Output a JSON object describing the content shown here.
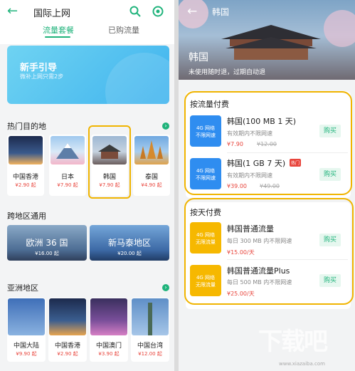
{
  "left": {
    "header": {
      "title": "国际上网"
    },
    "tabs": [
      {
        "label": "流量套餐"
      },
      {
        "label": "已购流量"
      }
    ],
    "banner": {
      "title": "新手引导",
      "subtitle": "微补上网只需2步"
    },
    "hot_section": {
      "title": "热门目的地"
    },
    "destinations": [
      {
        "name": "中国香港",
        "price": "¥2.90 起"
      },
      {
        "name": "日本",
        "price": "¥7.90 起"
      },
      {
        "name": "韩国",
        "price": "¥7.90 起"
      },
      {
        "name": "泰国",
        "price": "¥4.90 起"
      }
    ],
    "region_section": {
      "title": "跨地区通用"
    },
    "regions": [
      {
        "name": "欧洲 36 国",
        "price": "¥16.00 起"
      },
      {
        "name": "新马泰地区",
        "price": "¥20.00 起"
      }
    ],
    "asia_section": {
      "title": "亚洲地区"
    },
    "asia": [
      {
        "name": "中国大陆",
        "price": "¥9.90 起"
      },
      {
        "name": "中国香港",
        "price": "¥2.90 起"
      },
      {
        "name": "中国澳门",
        "price": "¥3.90 起"
      },
      {
        "name": "中国台湾",
        "price": "¥12.00 起"
      }
    ]
  },
  "right": {
    "header": {
      "title": "韩国"
    },
    "hero": {
      "title": "韩国",
      "subtitle": "未使用随时退，过期自动退"
    },
    "by_data": {
      "title": "按流量付费",
      "items": [
        {
          "title": "韩国(100 MB 1 天)",
          "desc": "有效期内不限网速",
          "price": "¥7.90",
          "old_price": "¥12.00",
          "icon": "4G 网络\n不限网速",
          "buy": "购买"
        },
        {
          "title": "韩国(1 GB 7 天)",
          "badge": "热门",
          "desc": "有效期内不限网速",
          "price": "¥39.00",
          "old_price": "¥49.00",
          "icon": "4G 网络\n不限网速",
          "buy": "购买"
        }
      ]
    },
    "by_day": {
      "title": "按天付费",
      "items": [
        {
          "title": "韩国普通流量",
          "desc": "每日 300 MB 内不限网速",
          "price": "¥15.00/天",
          "icon": "4G 网络\n无限流量",
          "buy": "购买"
        },
        {
          "title": "韩国普通流量Plus",
          "desc": "每日 500 MB 内不限网速",
          "price": "¥25.00/天",
          "icon": "4G 网络\n无限流量",
          "buy": "购买"
        }
      ]
    }
  },
  "colors": {
    "accent": "#1fb37b",
    "price": "#e8453c",
    "highlight": "#f0b400",
    "icon_blue": "#2f8df0",
    "icon_yellow": "#f6b800"
  },
  "watermark": {
    "text": "下载吧",
    "url": "www.xiazaiba.com"
  }
}
